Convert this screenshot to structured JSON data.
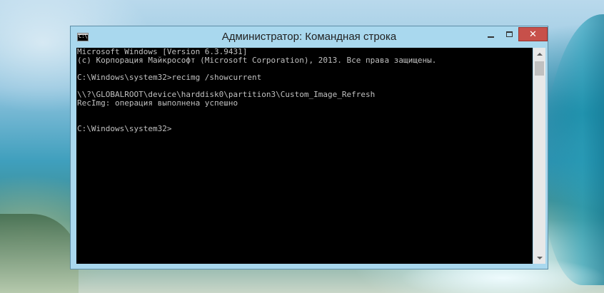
{
  "window": {
    "title": "Администратор: Командная строка",
    "close_label": "✕",
    "app_icon_glyph": "C:\\",
    "colors": {
      "frame": "#a9d8ee",
      "close": "#c7504a",
      "console_bg": "#000000",
      "console_fg": "#c0c0c0"
    }
  },
  "console": {
    "line1": "Microsoft Windows [Version 6.3.9431]",
    "line2": "(c) Корпорация Майкрософт (Microsoft Corporation), 2013. Все права защищены.",
    "line3": "C:\\Windows\\system32>recimg /showcurrent",
    "line4": "\\\\?\\GLOBALROOT\\device\\harddisk0\\partition3\\Custom_Image_Refresh",
    "line5": "RecImg: операция выполнена успешно",
    "line6": "C:\\Windows\\system32>"
  }
}
